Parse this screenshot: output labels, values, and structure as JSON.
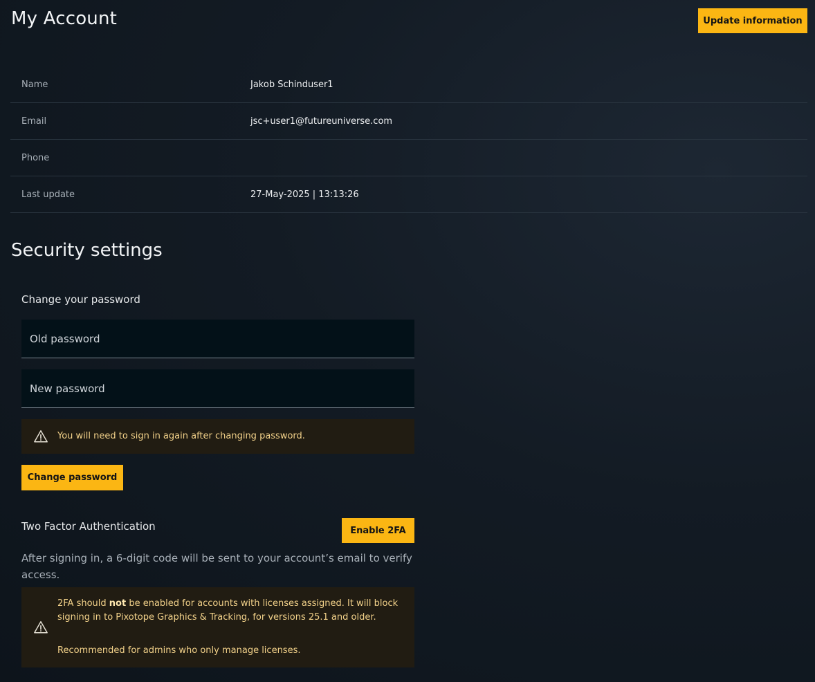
{
  "header": {
    "title": "My Account",
    "update_button": "Update information"
  },
  "account": {
    "rows": [
      {
        "label": "Name",
        "value": "Jakob Schinduser1"
      },
      {
        "label": "Email",
        "value": "jsc+user1@futureuniverse.com"
      },
      {
        "label": "Phone",
        "value": ""
      },
      {
        "label": "Last update",
        "value": "27-May-2025 | 13:13:26"
      }
    ]
  },
  "security": {
    "title": "Security settings",
    "password": {
      "heading": "Change your password",
      "old_placeholder": "Old password",
      "new_placeholder": "New password",
      "warning": "You will need to sign in again after changing password.",
      "button": "Change password"
    },
    "two_factor": {
      "heading": "Two Factor Authentication",
      "button": "Enable 2FA",
      "description": "After signing in, a 6-digit code will be sent to your account’s email to verify access.",
      "warning": {
        "pre": "2FA should ",
        "bold": "not",
        "post": " be enabled for accounts with licenses assigned. It will block signing in to Pixotope Graphics & Tracking, for versions 25.1 and older.",
        "note": "Recommended for admins who only manage licenses."
      }
    }
  },
  "colors": {
    "accent": "#fbb613",
    "warning_text": "#f3d28a",
    "warning_bg": "#211c12"
  },
  "icons": {
    "warning": "warning-triangle-icon"
  }
}
